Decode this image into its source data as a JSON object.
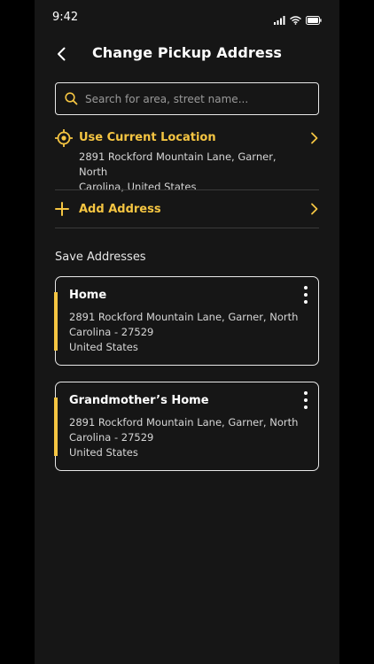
{
  "status_bar": {
    "time": "9:42"
  },
  "header": {
    "title": "Change Pickup Address"
  },
  "search": {
    "placeholder": "Search for area, street name..."
  },
  "current_location": {
    "label": "Use Current Location",
    "address_line1": "2891 Rockford Mountain Lane, Garner, North",
    "address_line2": "Carolina, United States"
  },
  "add_address": {
    "label": "Add Address"
  },
  "saved": {
    "title": "Save Addresses",
    "items": [
      {
        "name": "Home",
        "line1": "2891 Rockford Mountain Lane, Garner, North",
        "line2": "Carolina - 27529",
        "line3": "United States"
      },
      {
        "name": "Grandmother’s Home",
        "line1": "2891 Rockford Mountain Lane, Garner, North",
        "line2": "Carolina - 27529",
        "line3": "United States"
      }
    ]
  },
  "colors": {
    "accent": "#f5c542",
    "background": "#161616",
    "outer": "#000000"
  },
  "icons": [
    "signal-icon",
    "wifi-icon",
    "battery-icon",
    "back-arrow-icon",
    "search-icon",
    "target-location-icon",
    "plus-icon",
    "chevron-right-icon",
    "more-vertical-icon"
  ]
}
